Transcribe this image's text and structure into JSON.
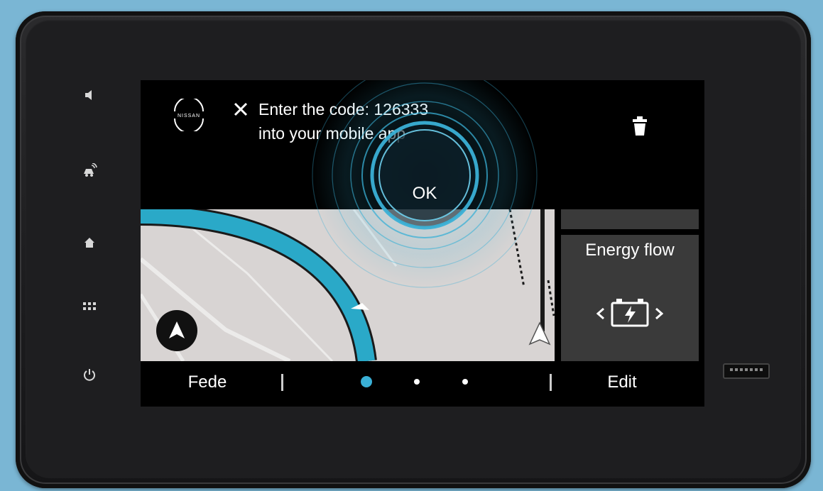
{
  "notification": {
    "line1": "Enter the code: 126333",
    "line2": "into your mobile app",
    "ok_label": "OK",
    "brand_logo_text": "NISSAN"
  },
  "widget": {
    "title": "Energy flow",
    "icon": "battery-charging-icon"
  },
  "bottom_bar": {
    "left_label": "Fede",
    "right_label": "Edit",
    "page_dots": 3,
    "active_dot": 0
  },
  "side_buttons": [
    "volume-icon",
    "voice-assistant-icon",
    "home-icon",
    "apps-grid-icon",
    "power-icon"
  ],
  "colors": {
    "accent": "#3ab0d6",
    "route": "#2aa9c8",
    "map_bg": "#d8d4d3",
    "widget_bg": "#3a3a3a",
    "bezel_bg": "#7ab6d4"
  }
}
